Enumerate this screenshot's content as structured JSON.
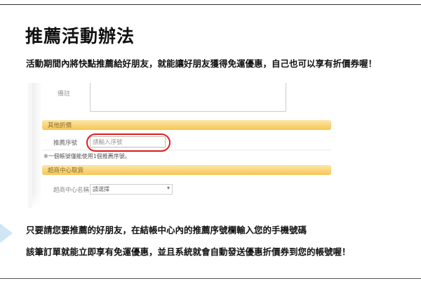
{
  "title": "推薦活動辦法",
  "intro": "活動期間內將快點推薦給好朋友，就能讓好朋友獲得免運優惠，自己也可以享有折價券喔！",
  "screenshot": {
    "notes_label": "備註",
    "section_other_discount": "其他折價",
    "referral_field_label": "推薦序號",
    "referral_placeholder": "請輸入序號",
    "referral_note": "※一個帳號僅能使用1個推薦序號。",
    "section_pickup_store": "超商中心取貨",
    "store_name_label": "超商中心名稱",
    "store_select_value": "請選擇",
    "highlight_color": "#e21e1e",
    "bar_color": "#f6c556"
  },
  "paragraph1": "只要請您要推薦的好朋友，在結帳中心內的推薦序號欄輸入您的手機號碼",
  "paragraph2": "該筆訂單就能立即享有免運優惠，並且系統就會自動發送優惠折價券到您的帳號喔！"
}
